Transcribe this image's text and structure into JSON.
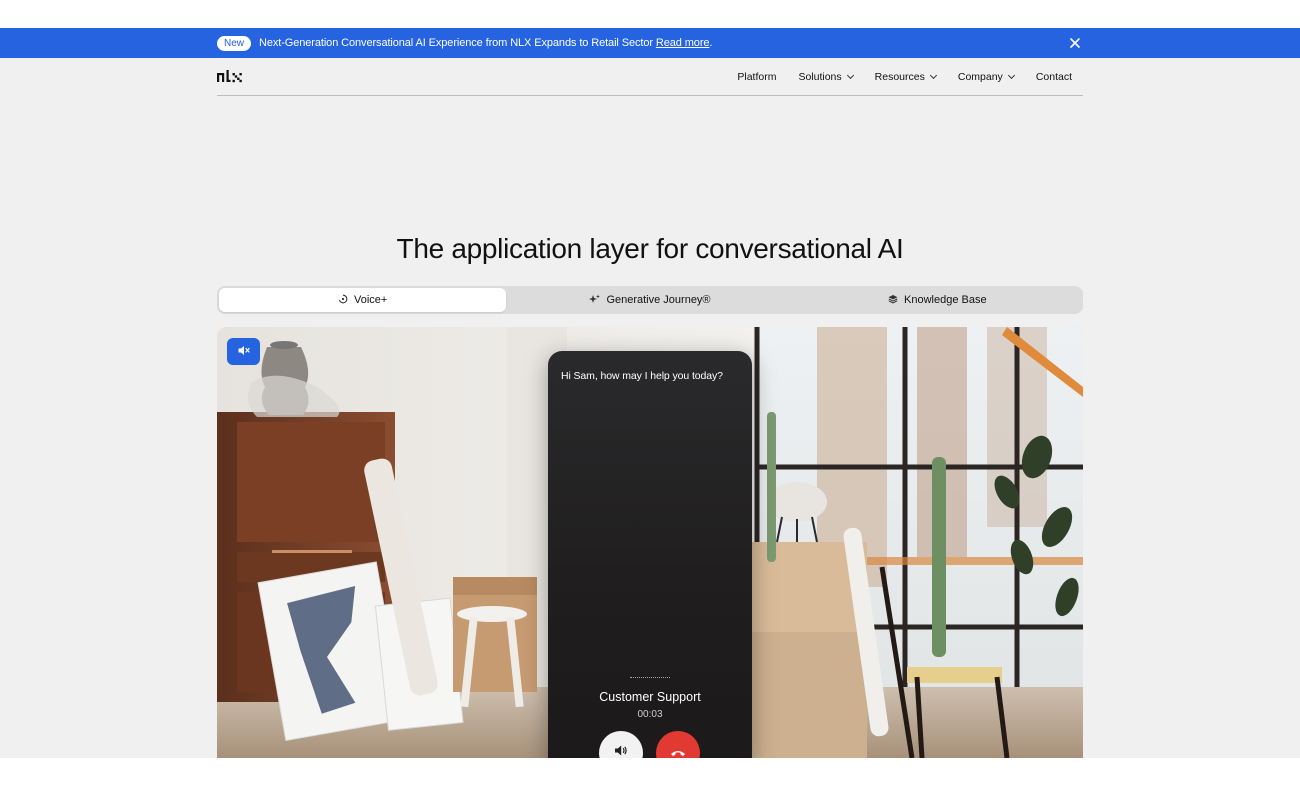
{
  "banner": {
    "badge": "New",
    "text": "Next-Generation Conversational AI Experience from NLX Expands to Retail Sector",
    "link": "Read more",
    "period": ".",
    "close_icon": "close-icon"
  },
  "nav": {
    "logo": "nlx",
    "items": [
      {
        "label": "Platform",
        "dropdown": false
      },
      {
        "label": "Solutions",
        "dropdown": true
      },
      {
        "label": "Resources",
        "dropdown": true
      },
      {
        "label": "Company",
        "dropdown": true
      },
      {
        "label": "Contact",
        "dropdown": false
      }
    ]
  },
  "hero": {
    "title": "The application layer for conversational AI"
  },
  "tabs": [
    {
      "label": "Voice+",
      "icon": "voice-icon",
      "active": true
    },
    {
      "label": "Generative Journey®",
      "icon": "sparkle-icon",
      "active": false
    },
    {
      "label": "Knowledge Base",
      "icon": "layers-icon",
      "active": false
    }
  ],
  "media": {
    "mute_icon": "mute-icon",
    "phone": {
      "greeting": "Hi Sam, how may I help you today?",
      "caller": "Customer Support",
      "timer": "00:03",
      "speaker_icon": "speaker-icon",
      "hangup_icon": "hang-up-icon"
    }
  },
  "colors": {
    "accent": "#2563e0",
    "hangup": "#e03a32",
    "page_bg": "#f0f0f0"
  }
}
